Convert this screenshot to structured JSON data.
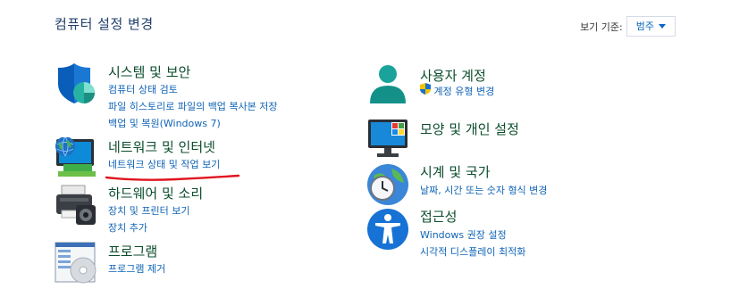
{
  "header": {
    "title": "컴퓨터 설정 변경",
    "view_by_label": "보기 기준:",
    "view_by_value": "범주"
  },
  "categories": [
    {
      "title": "시스템 및 보안",
      "icon": "security-shield-icon",
      "links": [
        "컴퓨터 상태 검토",
        "파일 히스토리로 파일의 백업 복사본 저장",
        "백업 및 복원(Windows 7)"
      ]
    },
    {
      "title": "네트워크 및 인터넷",
      "icon": "network-globe-icon",
      "links": [
        "네트워크 상태 및 작업 보기"
      ]
    },
    {
      "title": "하드웨어 및 소리",
      "icon": "printer-speaker-icon",
      "links": [
        "장치 및 프린터 보기",
        "장치 추가"
      ]
    },
    {
      "title": "프로그램",
      "icon": "programs-disc-icon",
      "links": [
        "프로그램 제거"
      ]
    },
    {
      "title": "사용자 계정",
      "icon": "user-account-icon",
      "links": [
        "계정 유형 변경"
      ]
    },
    {
      "title": "모양 및 개인 설정",
      "icon": "appearance-monitor-icon",
      "links": []
    },
    {
      "title": "시계 및 국가",
      "icon": "clock-globe-icon",
      "links": [
        "날짜, 시간 또는 숫자 형식 변경"
      ]
    },
    {
      "title": "접근성",
      "icon": "accessibility-person-icon",
      "links": [
        "Windows 권장 설정",
        "시각적 디스플레이 최적화"
      ]
    }
  ],
  "colors": {
    "accent": "#1064b6",
    "title": "#1f3e6b",
    "annotation": "#e0141e"
  }
}
